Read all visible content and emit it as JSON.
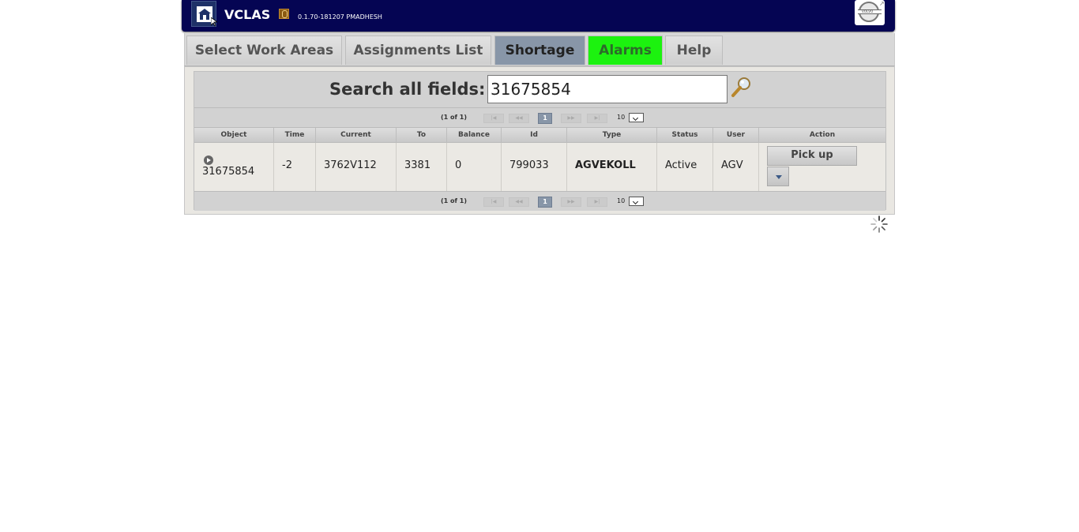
{
  "header": {
    "app_title": "VCLAS",
    "version": "0.1.70-181207 PMADHESH",
    "logo_text": "VOLVO"
  },
  "nav": {
    "tabs": [
      {
        "label": "Select Work Areas",
        "active": false
      },
      {
        "label": "Assignments List",
        "active": false
      },
      {
        "label": "Shortage",
        "active": true
      },
      {
        "label": "Alarms",
        "active": false
      },
      {
        "label": "Help",
        "active": false
      }
    ],
    "alarm_color": "#1cf20f",
    "active_color": "#8896a8"
  },
  "search": {
    "label": "Search all fields:",
    "value": "31675854"
  },
  "pager": {
    "info": "(1 of 1)",
    "current_page": "1",
    "rows_per_page": "10",
    "first": "|◀",
    "prev": "◀◀",
    "next": "▶▶",
    "last": "▶|"
  },
  "table": {
    "columns": [
      "Object",
      "Time",
      "Current",
      "To",
      "Balance",
      "Id",
      "Type",
      "Status",
      "User",
      "Action"
    ],
    "rows": [
      {
        "object": "31675854",
        "time": "-2",
        "current": "3762V112",
        "to": "3381",
        "balance": "0",
        "id": "799033",
        "type": "AGVEKOLL",
        "status": "Active",
        "user": "AGV",
        "action_label": "Pick up"
      }
    ]
  }
}
